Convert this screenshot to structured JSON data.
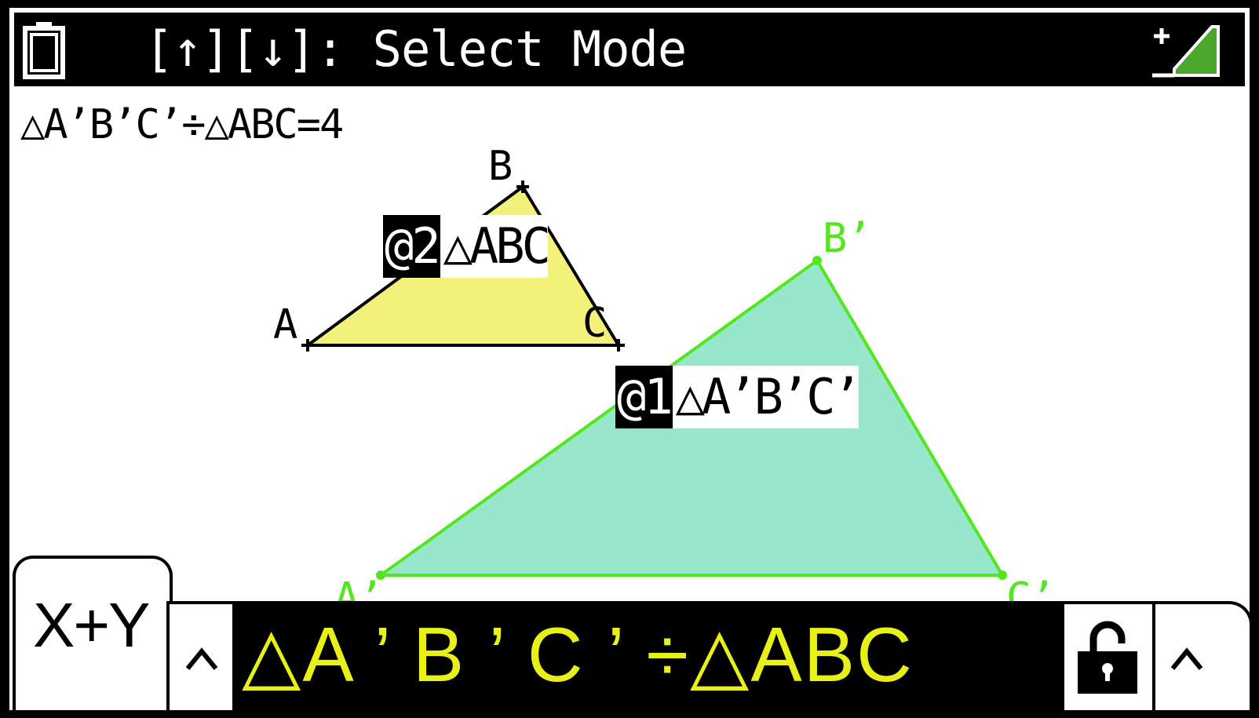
{
  "title_bar": {
    "text": "[↑][↓]: Select Mode"
  },
  "result": {
    "text": "△A’B’C’÷△ABC=4"
  },
  "triangles": [
    {
      "order": "@2",
      "name": "△ABC",
      "points": [
        "A",
        "B",
        "C"
      ],
      "fill": "#f2f27a",
      "stroke": "#000000"
    },
    {
      "order": "@1",
      "name": "△A’B’C’",
      "points": [
        "A’",
        "B’",
        "C’"
      ],
      "fill": "#98e6cc",
      "stroke": "#52e61c"
    }
  ],
  "tabs": {
    "xy_label": "X+Y"
  },
  "expression": {
    "text": "△A ’ B ’ C ’ ÷△ABC"
  },
  "colors": {
    "accent_yellow": "#e8f016",
    "green": "#52e61c",
    "teal_fill": "#98e6cc",
    "yellow_fill": "#f2f27a"
  },
  "icons": {
    "battery": "battery-icon",
    "signal": "signal-icon",
    "lock": "unlocked-padlock-icon",
    "caret": "caret-up-icon"
  }
}
